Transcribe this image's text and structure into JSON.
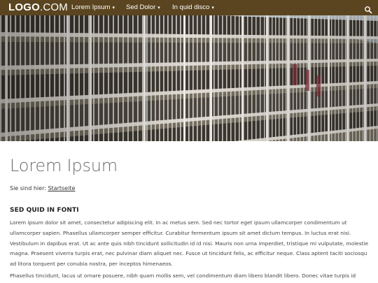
{
  "header": {
    "logo_bold": "LOGO",
    "logo_light": ".COM",
    "nav": [
      {
        "label": "Lorem Ipsum"
      },
      {
        "label": "Sed Dolor"
      },
      {
        "label": "In quid disco"
      }
    ]
  },
  "icons": {
    "search": "search-icon",
    "chevron": "chevron-down-icon"
  },
  "colors": {
    "header_bg": "#5a4520",
    "title": "#6b6b6b"
  },
  "main": {
    "title": "Lorem Ipsum",
    "breadcrumb_prefix": "Sie sind hier:",
    "breadcrumb_link": "Startseite",
    "section_heading": "SED QUID IN FONTI",
    "paragraphs": [
      "Lorem ipsum dolor sit amet, consectetur adipiscing elit. In ac metus sem. Sed nec tortor eget ipsum ullamcorper condimentum ut ullamcorper sapien. Phasellus ullamcorper semper efficitur. Curabitur fermentum ipsum sit amet dictum tempus. In luctus erat nisi. Vestibulum in dapibus erat. Ut ac ante quis nibh tincidunt sollicitudin id id nisi. Mauris non urna imperdiet, tristique mi vulputate, molestie magna. Praesent viverra turpis erat, nec pulvinar diam aliquet nec. Fusce ut tincidunt felis, ac efficitur neque. Class aptent taciti sociosqu ad litora torquent per conubia nostra, per inceptos himenaeos.",
      "Phasellus tincidunt, lacus ut ornare posuere, nibh quam mollis sem, vel condimentum diam libero blandit libero. Donec vitae turpis id enim"
    ]
  }
}
